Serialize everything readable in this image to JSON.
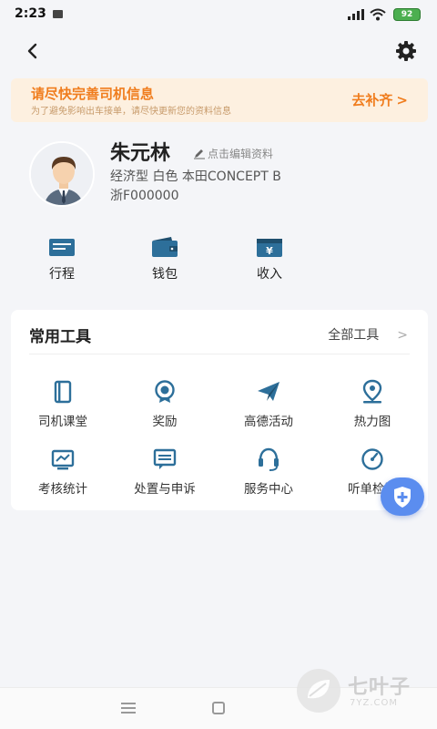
{
  "status_bar": {
    "time": "2:23",
    "battery": "92"
  },
  "banner": {
    "title": "请尽快完善司机信息",
    "subtitle": "为了避免影响出车接单，请尽快更新您的资料信息",
    "action": "去补齐",
    "action_arrow": ">"
  },
  "profile": {
    "name": "朱元林",
    "edit_label": "点击编辑资料",
    "car_info": "经济型 白色 本田CONCEPT B",
    "plate": "浙F000000"
  },
  "quick_actions": [
    {
      "label": "行程",
      "icon": "trip-icon"
    },
    {
      "label": "钱包",
      "icon": "wallet-icon"
    },
    {
      "label": "收入",
      "icon": "income-icon"
    }
  ],
  "tools": {
    "title": "常用工具",
    "all_label": "全部工具",
    "all_arrow": ">",
    "items": [
      {
        "label": "司机课堂",
        "icon": "book-icon"
      },
      {
        "label": "奖励",
        "icon": "medal-icon"
      },
      {
        "label": "高德活动",
        "icon": "paper-plane-icon"
      },
      {
        "label": "热力图",
        "icon": "map-pin-icon"
      },
      {
        "label": "考核统计",
        "icon": "chart-icon"
      },
      {
        "label": "处置与申诉",
        "icon": "message-icon"
      },
      {
        "label": "服务中心",
        "icon": "headset-icon"
      },
      {
        "label": "听单检测",
        "icon": "gauge-icon"
      }
    ]
  },
  "watermark": {
    "text": "七叶子",
    "sub": "7YZ.COM"
  },
  "colors": {
    "accent": "#f07d1e",
    "icon_blue": "#2d6f9a",
    "fab": "#5b8def",
    "banner_bg": "#fdf0e0"
  }
}
